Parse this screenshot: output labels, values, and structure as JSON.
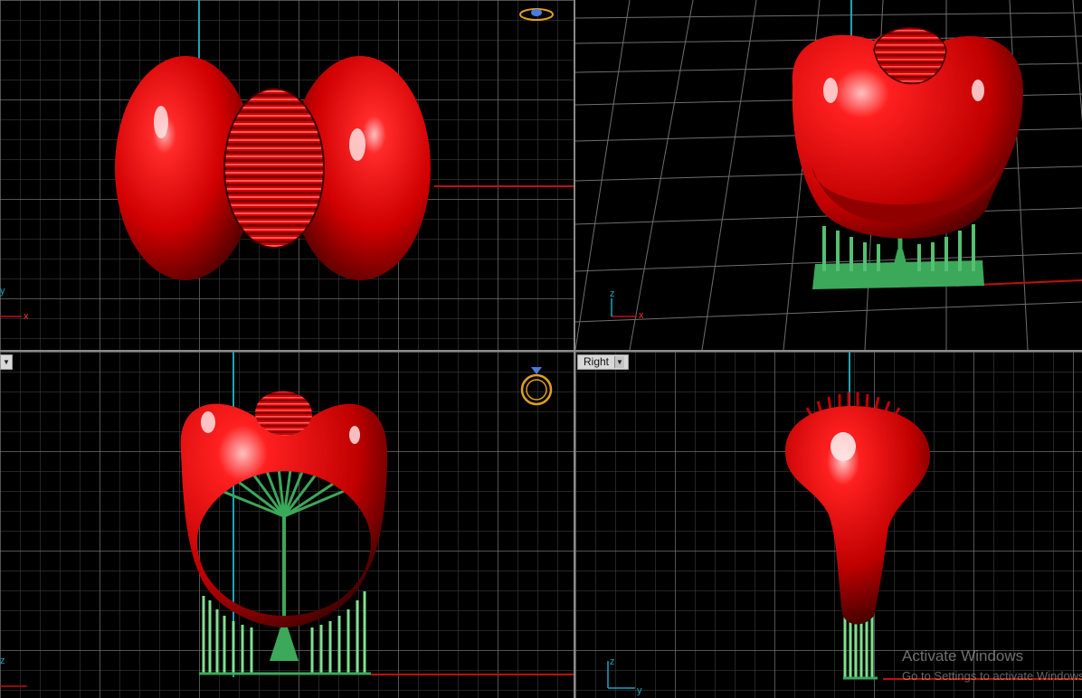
{
  "viewports": {
    "right_label": "Right",
    "axis": {
      "x": "x",
      "y": "y",
      "z": "z"
    }
  },
  "watermark": {
    "title": "Activate Windows",
    "subtitle": "Go to Settings to activate Windows."
  },
  "colors": {
    "model_red": "#e00000",
    "support_green": "#3cb85a",
    "axis_red": "#c01010",
    "axis_cyan": "#1aa6b7"
  }
}
